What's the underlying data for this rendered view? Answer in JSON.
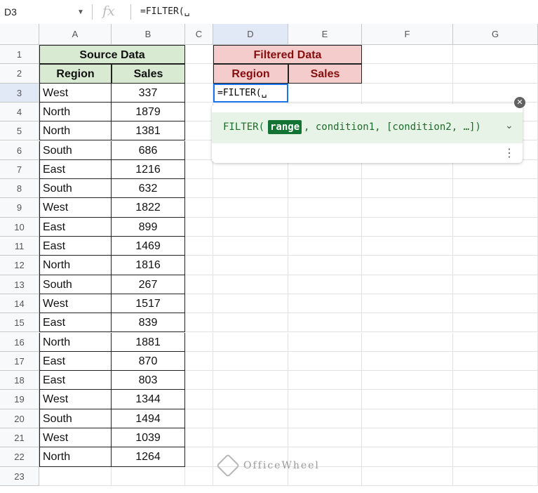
{
  "formula_bar": {
    "cell_ref": "D3",
    "fx": "fx",
    "formula": "=FILTER(␣"
  },
  "columns": [
    "A",
    "B",
    "C",
    "D",
    "E",
    "F",
    "G"
  ],
  "rows": [
    "1",
    "2",
    "3",
    "4",
    "5",
    "6",
    "7",
    "8",
    "9",
    "10",
    "11",
    "12",
    "13",
    "14",
    "15",
    "16",
    "17",
    "18",
    "19",
    "20",
    "21",
    "22",
    "23"
  ],
  "source": {
    "title": "Source Data",
    "headers": [
      "Region",
      "Sales"
    ],
    "data": [
      [
        "West",
        "337"
      ],
      [
        "North",
        "1879"
      ],
      [
        "North",
        "1381"
      ],
      [
        "South",
        "686"
      ],
      [
        "East",
        "1216"
      ],
      [
        "South",
        "632"
      ],
      [
        "West",
        "1822"
      ],
      [
        "East",
        "899"
      ],
      [
        "East",
        "1469"
      ],
      [
        "North",
        "1816"
      ],
      [
        "South",
        "267"
      ],
      [
        "West",
        "1517"
      ],
      [
        "East",
        "839"
      ],
      [
        "North",
        "1881"
      ],
      [
        "East",
        "870"
      ],
      [
        "East",
        "803"
      ],
      [
        "West",
        "1344"
      ],
      [
        "South",
        "1494"
      ],
      [
        "West",
        "1039"
      ],
      [
        "North",
        "1264"
      ]
    ]
  },
  "filtered": {
    "title": "Filtered Data",
    "headers": [
      "Region",
      "Sales"
    ]
  },
  "editing_cell": "=FILTER(␣",
  "tooltip": {
    "func": "FILTER(",
    "param": "range",
    "rest": ", condition1, [condition2, …])",
    "chevron": "⌵"
  },
  "watermark": "OfficeWheel",
  "colors": {
    "source_bg": "#d9ead3",
    "filtered_bg": "#f4cccc",
    "filtered_text": "#850e0e",
    "selection": "#1a73e8"
  }
}
